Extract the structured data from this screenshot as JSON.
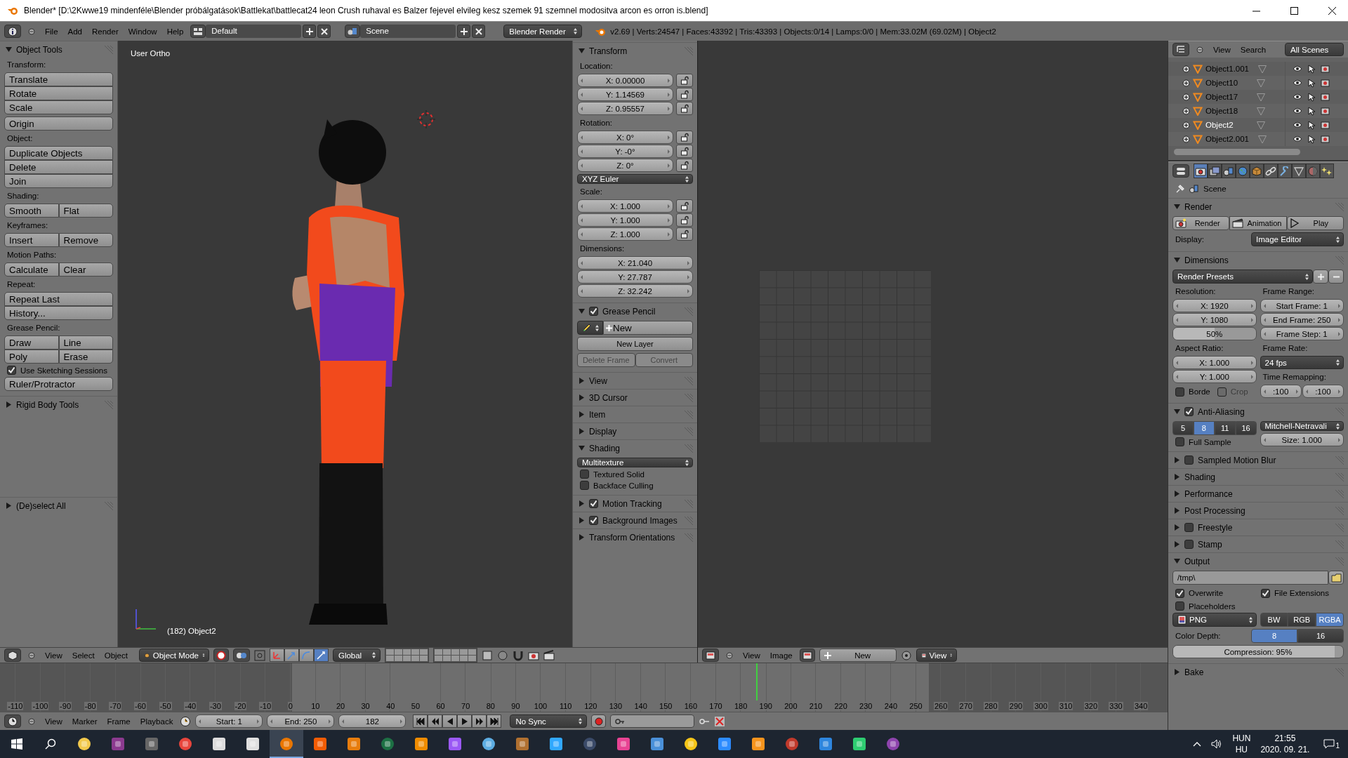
{
  "window": {
    "title": "Blender* [D:\\2Kwwe19 mindenféle\\Blender próbálgatások\\Battlekat\\battlecat24 leon Crush ruhaval es Balzer fejevel elvileg kesz szemek 91 szemnel modositva  arcon es orron is.blend]"
  },
  "info_header": {
    "menus": [
      "File",
      "Add",
      "Render",
      "Window",
      "Help"
    ],
    "layout": "Default",
    "scene": "Scene",
    "engine": "Blender Render",
    "stats": "v2.69 | Verts:24547 | Faces:43392 | Tris:43393 | Objects:0/14 | Lamps:0/0 | Mem:33.02M (69.02M) | Object2"
  },
  "tool_shelf": {
    "panels": [
      {
        "title": "Object Tools",
        "expanded": true,
        "rows": [
          {
            "kind": "label",
            "text": "Transform:"
          },
          {
            "kind": "stack",
            "rows": [
              [
                "Translate"
              ],
              [
                "Rotate"
              ],
              [
                "Scale"
              ]
            ]
          },
          {
            "kind": "stack",
            "rows": [
              [
                "Origin"
              ]
            ]
          },
          {
            "kind": "label",
            "text": "Object:"
          },
          {
            "kind": "stack",
            "rows": [
              [
                "Duplicate Objects"
              ],
              [
                "Delete"
              ],
              [
                "Join"
              ]
            ]
          },
          {
            "kind": "label",
            "text": "Shading:"
          },
          {
            "kind": "stack",
            "rows": [
              [
                "Smooth",
                "Flat"
              ]
            ]
          },
          {
            "kind": "label",
            "text": "Keyframes:"
          },
          {
            "kind": "stack",
            "rows": [
              [
                "Insert",
                "Remove"
              ]
            ]
          },
          {
            "kind": "label",
            "text": "Motion Paths:"
          },
          {
            "kind": "stack",
            "rows": [
              [
                "Calculate",
                "Clear"
              ]
            ]
          },
          {
            "kind": "label",
            "text": "Repeat:"
          },
          {
            "kind": "stack",
            "rows": [
              [
                "Repeat Last"
              ],
              [
                "History..."
              ]
            ]
          },
          {
            "kind": "label",
            "text": "Grease Pencil:"
          },
          {
            "kind": "stack",
            "rows": [
              [
                "Draw",
                "Line"
              ],
              [
                "Poly",
                "Erase"
              ]
            ]
          },
          {
            "kind": "checkbox",
            "text": "Use Sketching Sessions",
            "checked": true
          },
          {
            "kind": "stack",
            "rows": [
              [
                "Ruler/Protractor"
              ]
            ]
          }
        ]
      },
      {
        "title": "Rigid Body Tools",
        "expanded": false
      }
    ],
    "bottom_panels": [
      {
        "title": "(De)select All",
        "expanded": false
      }
    ]
  },
  "viewport": {
    "view_name": "User Ortho",
    "object_info": "(182) Object2"
  },
  "n_panel": {
    "panels": [
      {
        "title": "Transform",
        "expanded": true,
        "rows": [
          {
            "kind": "label",
            "text": "Location:"
          },
          {
            "kind": "fields",
            "fields": [
              {
                "text": "X: 0.00000",
                "locked": false
              },
              {
                "text": "Y: 1.14569",
                "locked": false
              },
              {
                "text": "Z: 0.95557",
                "locked": false
              }
            ]
          },
          {
            "kind": "label",
            "text": "Rotation:"
          },
          {
            "kind": "fields",
            "fields": [
              {
                "text": "X: 0°",
                "locked": false
              },
              {
                "text": "Y: -0°",
                "locked": false
              },
              {
                "text": "Z: 0°",
                "locked": false
              }
            ]
          },
          {
            "kind": "dropdown",
            "text": "XYZ Euler"
          },
          {
            "kind": "label",
            "text": "Scale:"
          },
          {
            "kind": "fields",
            "fields": [
              {
                "text": "X: 1.000",
                "locked": false
              },
              {
                "text": "Y: 1.000",
                "locked": false
              },
              {
                "text": "Z: 1.000",
                "locked": false
              }
            ]
          },
          {
            "kind": "label",
            "text": "Dimensions:"
          },
          {
            "kind": "fields",
            "fields": [
              {
                "text": "X: 21.040"
              },
              {
                "text": "Y: 27.787"
              },
              {
                "text": "Z: 32.242"
              }
            ]
          }
        ]
      },
      {
        "title": "Grease Pencil",
        "expanded": true,
        "checked": true,
        "rows": [
          {
            "kind": "grease_new",
            "text": "New"
          },
          {
            "kind": "buttons",
            "buttons": [
              {
                "text": "New Layer",
                "disabled": false
              }
            ]
          },
          {
            "kind": "buttons",
            "buttons": [
              {
                "text": "Delete Frame",
                "disabled": true
              },
              {
                "text": "Convert",
                "disabled": true
              }
            ]
          }
        ]
      },
      {
        "title": "View",
        "expanded": false
      },
      {
        "title": "3D Cursor",
        "expanded": false
      },
      {
        "title": "Item",
        "expanded": false
      },
      {
        "title": "Display",
        "expanded": false
      },
      {
        "title": "Shading",
        "expanded": true,
        "rows": [
          {
            "kind": "dropdown",
            "text": "Multitexture"
          },
          {
            "kind": "checkbox",
            "text": "Textured Solid",
            "checked": false
          },
          {
            "kind": "checkbox",
            "text": "Backface Culling",
            "checked": false
          }
        ]
      },
      {
        "title": "Motion Tracking",
        "expanded": false,
        "checked": true
      },
      {
        "title": "Background Images",
        "expanded": false,
        "checked": true
      },
      {
        "title": "Transform Orientations",
        "expanded": false
      }
    ]
  },
  "view3d_header": {
    "menus": [
      "View",
      "Select",
      "Object"
    ],
    "mode": "Object Mode",
    "orientation": "Global"
  },
  "image_editor": {
    "menus": [
      "View",
      "Image"
    ],
    "new_button": "New",
    "view_menu": "View"
  },
  "timeline": {
    "ruler_labels": [
      "-110",
      "-100",
      "-90",
      "-80",
      "-70",
      "-60",
      "-50",
      "-40",
      "-30",
      "-20",
      "-10",
      "0",
      "10",
      "20",
      "30",
      "40",
      "50",
      "60",
      "70",
      "80",
      "90",
      "100",
      "110",
      "120",
      "130",
      "140",
      "150",
      "160",
      "170",
      "180",
      "190",
      "200",
      "210",
      "220",
      "230",
      "240",
      "250",
      "260",
      "270",
      "280",
      "290",
      "300",
      "310",
      "320",
      "330",
      "340"
    ],
    "menus": [
      "View",
      "Marker",
      "Frame",
      "Playback"
    ],
    "start": "Start: 1",
    "end": "End: 250",
    "current_frame": "182",
    "sync": "No Sync"
  },
  "outliner": {
    "menus": [
      "View",
      "Search"
    ],
    "filter": "All Scenes",
    "rows": [
      {
        "name": "Object1.001",
        "selected": false
      },
      {
        "name": "Object10",
        "selected": false
      },
      {
        "name": "Object17",
        "selected": false
      },
      {
        "name": "Object18",
        "selected": false
      },
      {
        "name": "Object2",
        "selected": true
      },
      {
        "name": "Object2.001",
        "selected": false
      }
    ]
  },
  "properties": {
    "tabs": [
      {
        "selected": true
      },
      {
        "selected": false
      },
      {
        "selected": false
      },
      {
        "selected": false
      },
      {
        "selected": false
      },
      {
        "selected": false
      },
      {
        "selected": false
      },
      {
        "selected": false
      },
      {
        "selected": false
      },
      {
        "selected": false
      }
    ],
    "context": "Scene",
    "panels": [
      {
        "title": "Render",
        "expanded": true,
        "rows": [
          {
            "kind": "render_buttons",
            "buttons": [
              "Render",
              "Animation",
              "Play"
            ]
          },
          {
            "kind": "labeled_dropdown",
            "label": "Display:",
            "text": "Image Editor"
          }
        ]
      },
      {
        "title": "Dimensions",
        "expanded": true,
        "rows": [
          {
            "kind": "presets",
            "text": "Render Presets"
          },
          {
            "kind": "columns",
            "columns": [
              [
                {
                  "kind": "label",
                  "text": "Resolution:"
                },
                {
                  "kind": "fields",
                  "fields": [
                    {
                      "text": "X: 1920"
                    },
                    {
                      "text": "Y: 1080"
                    },
                    {
                      "text": "50%",
                      "level": 0.5
                    }
                  ]
                },
                {
                  "kind": "label",
                  "text": "Aspect Ratio:"
                },
                {
                  "kind": "fields",
                  "fields": [
                    {
                      "text": "X: 1.000"
                    },
                    {
                      "text": "Y: 1.000"
                    }
                  ]
                },
                {
                  "kind": "checkboxes",
                  "items": [
                    {
                      "text": "Borde",
                      "checked": false,
                      "disabled": false
                    },
                    {
                      "text": "Crop",
                      "checked": false,
                      "disabled": true
                    }
                  ]
                }
              ],
              [
                {
                  "kind": "label",
                  "text": "Frame Range:"
                },
                {
                  "kind": "fields",
                  "fields": [
                    {
                      "text": "Start Frame: 1"
                    },
                    {
                      "text": "End Frame: 250"
                    },
                    {
                      "text": "Frame Step: 1"
                    }
                  ]
                },
                {
                  "kind": "label",
                  "text": "Frame Rate:"
                },
                {
                  "kind": "dropdown",
                  "text": "24 fps"
                },
                {
                  "kind": "label",
                  "text": "Time Remapping:"
                },
                {
                  "kind": "fields",
                  "horizontal": true,
                  "fields": [
                    {
                      "text": ":100"
                    },
                    {
                      "text": ":100"
                    }
                  ]
                }
              ]
            ]
          }
        ]
      },
      {
        "title": "Anti-Aliasing",
        "expanded": true,
        "checked": true,
        "rows": [
          {
            "kind": "columns",
            "columns": [
              [
                {
                  "kind": "buttons",
                  "buttons": [
                    {
                      "text": "5",
                      "selected": false
                    },
                    {
                      "text": "8",
                      "selected": true
                    },
                    {
                      "text": "11",
                      "selected": false
                    },
                    {
                      "text": "16",
                      "selected": false
                    }
                  ]
                },
                {
                  "kind": "checkbox",
                  "text": "Full Sample",
                  "checked": false
                }
              ],
              [
                {
                  "kind": "dropdown",
                  "text": "Mitchell-Netravali"
                },
                {
                  "kind": "fields",
                  "fields": [
                    {
                      "text": "Size: 1.000"
                    }
                  ]
                }
              ]
            ]
          }
        ]
      },
      {
        "title": "Sampled Motion Blur",
        "expanded": false,
        "checked": false
      },
      {
        "title": "Shading",
        "expanded": false
      },
      {
        "title": "Performance",
        "expanded": false
      },
      {
        "title": "Post Processing",
        "expanded": false
      },
      {
        "title": "Freestyle",
        "expanded": false,
        "checked": false
      },
      {
        "title": "Stamp",
        "expanded": false,
        "checked": false
      },
      {
        "title": "Output",
        "expanded": true,
        "rows": [
          {
            "kind": "path",
            "text": "/tmp\\"
          },
          {
            "kind": "checkboxes",
            "items": [
              {
                "text": "Overwrite",
                "checked": true
              },
              {
                "text": "File Extensions",
                "checked": true
              }
            ]
          },
          {
            "kind": "checkbox",
            "text": "Placeholders",
            "checked": false
          },
          {
            "kind": "columns",
            "columns": [
              [
                {
                  "kind": "file_format",
                  "text": "PNG"
                }
              ],
              [
                {
                  "kind": "buttons",
                  "buttons": [
                    {
                      "text": "BW",
                      "selected": false
                    },
                    {
                      "text": "RGB",
                      "selected": false
                    },
                    {
                      "text": "RGBA",
                      "selected": true
                    }
                  ]
                }
              ]
            ]
          },
          {
            "kind": "labeled_buttons",
            "label": "Color Depth:",
            "buttons": [
              {
                "text": "8",
                "selected": true
              },
              {
                "text": "16",
                "selected": false
              }
            ]
          },
          {
            "kind": "fields",
            "fields": [
              {
                "text": "Compression: 95%",
                "level": 0.95
              }
            ]
          }
        ]
      },
      {
        "title": "Bake",
        "expanded": false
      }
    ]
  },
  "taskbar": {
    "apps": [
      {
        "selected": false
      },
      {
        "selected": false
      },
      {
        "selected": false
      },
      {
        "selected": false
      },
      {
        "selected": false
      },
      {
        "selected": false
      },
      {
        "selected": true
      },
      {
        "selected": false
      },
      {
        "selected": false
      },
      {
        "selected": false
      },
      {
        "selected": false
      },
      {
        "selected": false
      },
      {
        "selected": false
      },
      {
        "selected": false
      },
      {
        "selected": false
      },
      {
        "selected": false
      },
      {
        "selected": false
      },
      {
        "selected": false
      },
      {
        "selected": false
      },
      {
        "selected": false
      },
      {
        "selected": false
      },
      {
        "selected": false
      },
      {
        "selected": false
      },
      {
        "selected": false
      },
      {
        "selected": false
      }
    ],
    "language": "HUN",
    "layout": "HU",
    "time": "21:55",
    "date": "2020. 09. 21.",
    "notifications": "1"
  }
}
